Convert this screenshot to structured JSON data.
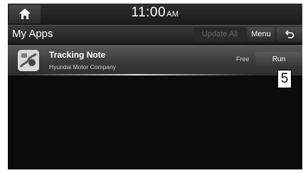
{
  "status_bar": {
    "time": "11:00",
    "ampm": "AM"
  },
  "header": {
    "title": "My Apps",
    "update_all_label": "Update All",
    "menu_label": "Menu"
  },
  "apps": [
    {
      "name": "Tracking Note",
      "company": "Hyundai Motor Company",
      "price": "Free",
      "action_label": "Run"
    }
  ],
  "callout_number": "5",
  "icons": {
    "home": "home-icon",
    "back": "back-arrow-icon",
    "app": "tracking-note-app-icon"
  },
  "colors": {
    "background": "#0b0b0b",
    "text": "#ffffff",
    "disabled_text": "#6a6a6a"
  }
}
